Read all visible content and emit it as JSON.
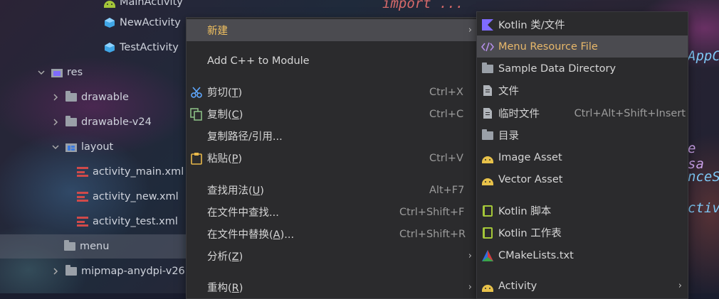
{
  "editor": {
    "code_top": "import ...",
    "code_right_1": "AppC",
    "code_right_2": "e sa",
    "code_right_3": "nceS",
    "code_right_4": "ctiv"
  },
  "tree": {
    "items": [
      {
        "label": "MainActivity",
        "icon": "android-icon"
      },
      {
        "label": "NewActivity",
        "icon": "class-icon"
      },
      {
        "label": "TestActivity",
        "icon": "class-icon"
      },
      {
        "label": "res",
        "icon": "res-folder-icon"
      },
      {
        "label": "drawable",
        "icon": "folder-icon"
      },
      {
        "label": "drawable-v24",
        "icon": "folder-icon"
      },
      {
        "label": "layout",
        "icon": "layout-folder-icon"
      },
      {
        "label": "activity_main.xml",
        "icon": "xml-icon"
      },
      {
        "label": "activity_new.xml",
        "icon": "xml-icon"
      },
      {
        "label": "activity_test.xml",
        "icon": "xml-icon"
      },
      {
        "label": "menu",
        "icon": "folder-icon",
        "selected": true
      },
      {
        "label": "mipmap-anydpi-v26",
        "icon": "folder-icon"
      }
    ]
  },
  "context_menu": {
    "new": {
      "pre": "新建",
      "key": "",
      "post": ""
    },
    "add_cpp": {
      "pre": "Add C++ to Module",
      "key": "",
      "post": ""
    },
    "cut": {
      "pre": "剪切(",
      "key": "T",
      "post": ")",
      "shortcut": "Ctrl+X"
    },
    "copy": {
      "pre": "复制(",
      "key": "C",
      "post": ")",
      "shortcut": "Ctrl+C"
    },
    "copy_path": {
      "pre": "复制路径/引用...",
      "key": "",
      "post": ""
    },
    "paste": {
      "pre": "粘贴(",
      "key": "P",
      "post": ")",
      "shortcut": "Ctrl+V"
    },
    "find_usages": {
      "pre": "查找用法(",
      "key": "U",
      "post": ")",
      "shortcut": "Alt+F7"
    },
    "find_in_files": {
      "pre": "在文件中查找...",
      "key": "",
      "post": "",
      "shortcut": "Ctrl+Shift+F"
    },
    "replace_in_files": {
      "pre": "在文件中替换(",
      "key": "A",
      "post": ")...",
      "shortcut": "Ctrl+Shift+R"
    },
    "analyze": {
      "pre": "分析(",
      "key": "Z",
      "post": ")"
    },
    "refactor": {
      "pre": "重构(",
      "key": "R",
      "post": ")"
    }
  },
  "new_submenu": {
    "kotlin_class": {
      "label": "Kotlin 类/文件"
    },
    "menu_resource": {
      "label": "Menu Resource File"
    },
    "sample_data": {
      "label": "Sample Data Directory"
    },
    "file": {
      "label": "文件"
    },
    "scratch": {
      "label": "临时文件",
      "shortcut": "Ctrl+Alt+Shift+Insert"
    },
    "directory": {
      "label": "目录"
    },
    "image_asset": {
      "label": "Image Asset"
    },
    "vector_asset": {
      "label": "Vector Asset"
    },
    "kotlin_script": {
      "label": "Kotlin 脚本"
    },
    "kotlin_worksheet": {
      "label": "Kotlin 工作表"
    },
    "cmake": {
      "label": "CMakeLists.txt"
    },
    "activity": {
      "label": "Activity"
    }
  },
  "colors": {
    "accent_highlight": "#4b4b50",
    "new_label": "#f0c060",
    "menu_resource_label": "#e8b86a",
    "kotlin_purple": "#7f6bff",
    "android_green": "#a4c639"
  }
}
